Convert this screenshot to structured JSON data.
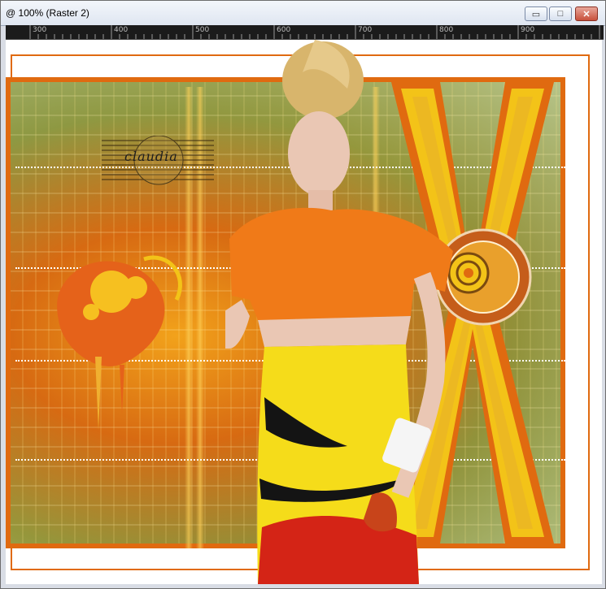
{
  "window": {
    "title": "@ 100% (Raster 2)",
    "buttons": {
      "minimize": "▭",
      "maximize": "□",
      "close": "✕"
    }
  },
  "ruler": {
    "labels": [
      "300",
      "400",
      "500",
      "600",
      "700",
      "800",
      "900"
    ]
  },
  "canvas": {
    "watermark_text": "claudia"
  },
  "colors": {
    "accent_orange": "#e06a10",
    "accent_yellow": "#f3c318",
    "frame_white": "#ffffff",
    "ruler_bg": "#1b1b1b"
  }
}
